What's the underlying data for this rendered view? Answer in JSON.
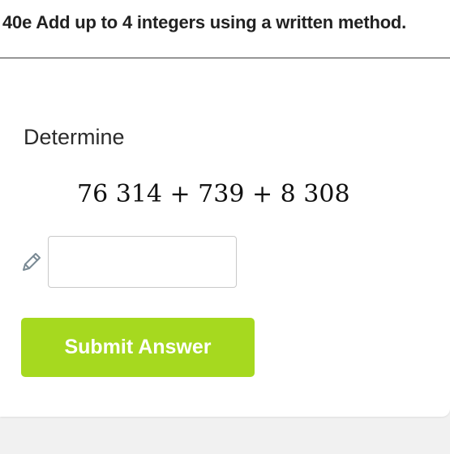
{
  "header": {
    "title": "40e Add up to 4 integers using a written method."
  },
  "question": {
    "prompt": "Determine",
    "expression": "76 314 + 739 + 8 308"
  },
  "answer": {
    "value": "",
    "placeholder": ""
  },
  "actions": {
    "submit_label": "Submit Answer"
  },
  "colors": {
    "submit_button": "#a6d91f",
    "pencil_icon": "#7a8a94"
  },
  "icons": {
    "answer_indicator": "pencil-icon"
  }
}
